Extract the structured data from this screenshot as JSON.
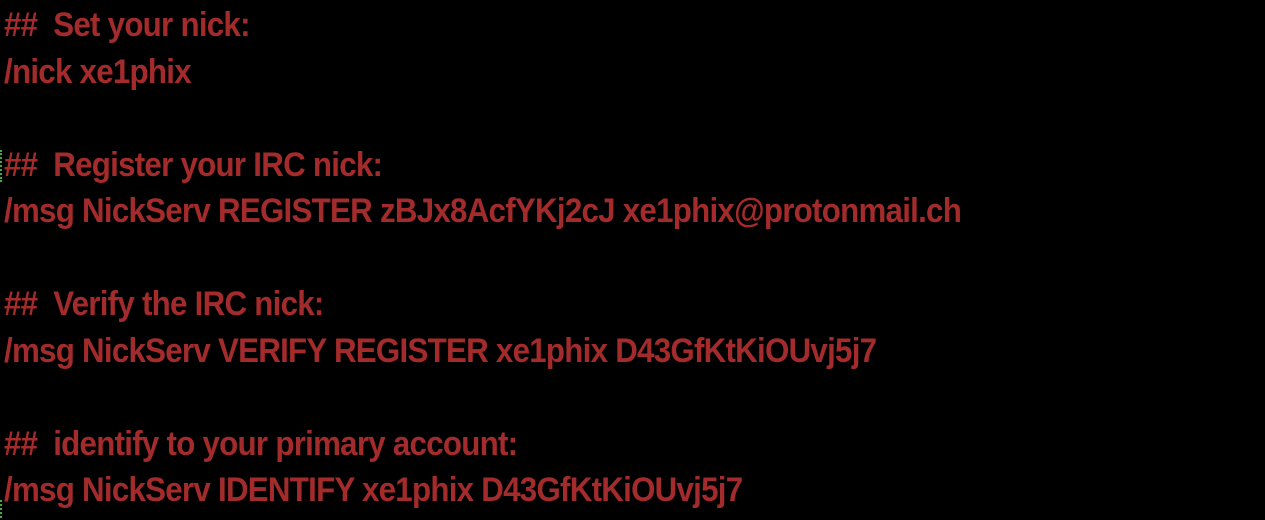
{
  "lines": [
    "##  Set your nick:",
    "/nick xe1phix",
    "",
    "##  Register your IRC nick:",
    "/msg NickServ REGISTER zBJx8AcfYKj2cJ xe1phix@protonmail.ch",
    "",
    "##  Verify the IRC nick:",
    "/msg NickServ VERIFY REGISTER xe1phix D43GfKtKiOUvj5j7",
    "",
    "##  identify to your primary account:",
    "/msg NickServ IDENTIFY xe1phix D43GfKtKiOUvj5j7"
  ],
  "colors": {
    "background": "#000000",
    "text": "#a32b2b",
    "cursor_mark": "#3fae3f"
  }
}
